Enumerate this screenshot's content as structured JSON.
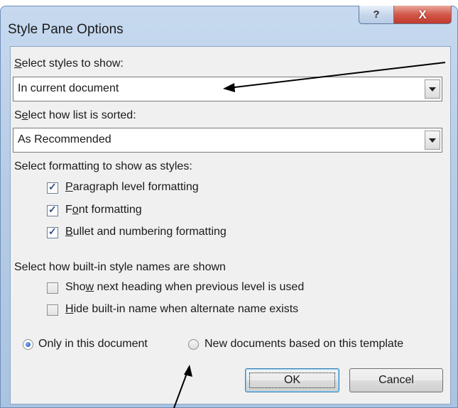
{
  "window": {
    "title": "Style Pane Options",
    "help_glyph": "?",
    "close_glyph": "X"
  },
  "styles_to_show": {
    "label_mnemonic": "S",
    "label_rest": "elect styles to show:",
    "selected": "In current document"
  },
  "sort": {
    "label_pre": "S",
    "label_mnemonic": "e",
    "label_rest": "lect how list is sorted:",
    "selected": "As Recommended"
  },
  "formatting": {
    "label": "Select formatting to show as styles:",
    "options": [
      {
        "pre": "",
        "mnemonic": "P",
        "rest": "aragraph level formatting",
        "checked": true
      },
      {
        "pre": "F",
        "mnemonic": "o",
        "rest": "nt formatting",
        "checked": true
      },
      {
        "pre": "",
        "mnemonic": "B",
        "rest": "ullet and numbering formatting",
        "checked": true
      }
    ]
  },
  "builtin_names": {
    "label": "Select how built-in style names are shown",
    "options": [
      {
        "pre": "Sho",
        "mnemonic": "w",
        "rest": " next heading when previous level is used",
        "checked": false
      },
      {
        "pre": "",
        "mnemonic": "H",
        "rest": "ide built-in name when alternate name exists",
        "checked": false
      }
    ]
  },
  "scope": {
    "only_this": "Only in this document",
    "new_docs": "New documents based on this template",
    "selected": "only_this"
  },
  "buttons": {
    "ok": "OK",
    "cancel": "Cancel"
  },
  "icons": [
    "help-icon",
    "close-icon",
    "dropdown-arrow-icon",
    "checkbox-checked-icon",
    "radio-selected-icon"
  ],
  "colors": {
    "frame": "#b6cce6",
    "close_button": "#c0392b",
    "dialog_body": "#f0f0f0",
    "check_mark": "#2f4f8a"
  }
}
